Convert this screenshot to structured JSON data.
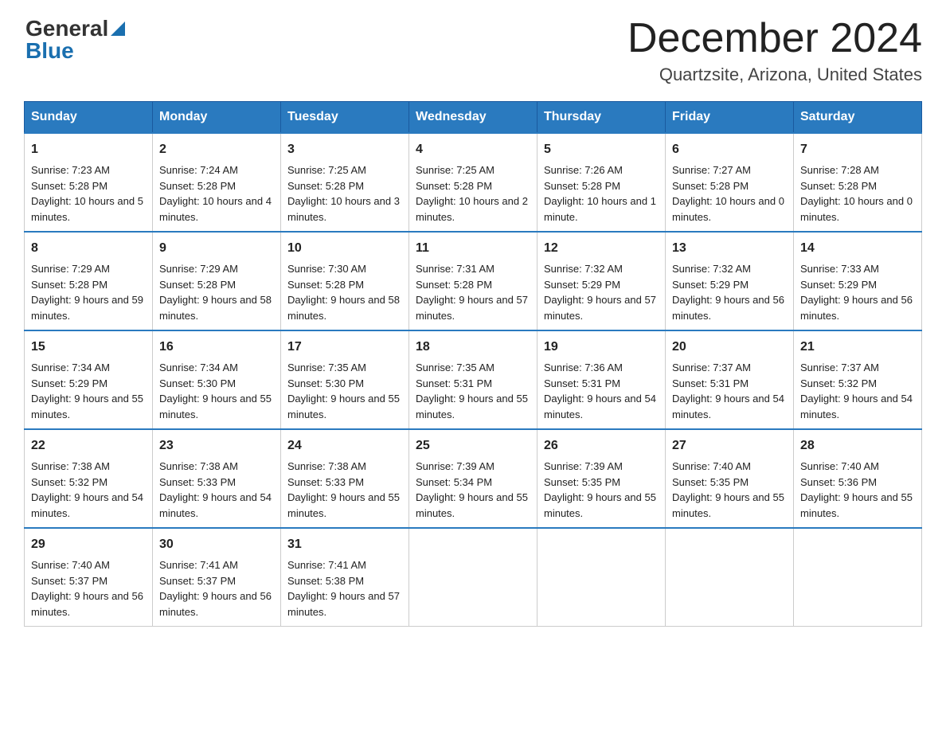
{
  "logo": {
    "general": "General",
    "blue": "Blue"
  },
  "title": "December 2024",
  "subtitle": "Quartzsite, Arizona, United States",
  "weekdays": [
    "Sunday",
    "Monday",
    "Tuesday",
    "Wednesday",
    "Thursday",
    "Friday",
    "Saturday"
  ],
  "weeks": [
    [
      {
        "day": "1",
        "sunrise": "7:23 AM",
        "sunset": "5:28 PM",
        "daylight": "10 hours and 5 minutes."
      },
      {
        "day": "2",
        "sunrise": "7:24 AM",
        "sunset": "5:28 PM",
        "daylight": "10 hours and 4 minutes."
      },
      {
        "day": "3",
        "sunrise": "7:25 AM",
        "sunset": "5:28 PM",
        "daylight": "10 hours and 3 minutes."
      },
      {
        "day": "4",
        "sunrise": "7:25 AM",
        "sunset": "5:28 PM",
        "daylight": "10 hours and 2 minutes."
      },
      {
        "day": "5",
        "sunrise": "7:26 AM",
        "sunset": "5:28 PM",
        "daylight": "10 hours and 1 minute."
      },
      {
        "day": "6",
        "sunrise": "7:27 AM",
        "sunset": "5:28 PM",
        "daylight": "10 hours and 0 minutes."
      },
      {
        "day": "7",
        "sunrise": "7:28 AM",
        "sunset": "5:28 PM",
        "daylight": "10 hours and 0 minutes."
      }
    ],
    [
      {
        "day": "8",
        "sunrise": "7:29 AM",
        "sunset": "5:28 PM",
        "daylight": "9 hours and 59 minutes."
      },
      {
        "day": "9",
        "sunrise": "7:29 AM",
        "sunset": "5:28 PM",
        "daylight": "9 hours and 58 minutes."
      },
      {
        "day": "10",
        "sunrise": "7:30 AM",
        "sunset": "5:28 PM",
        "daylight": "9 hours and 58 minutes."
      },
      {
        "day": "11",
        "sunrise": "7:31 AM",
        "sunset": "5:28 PM",
        "daylight": "9 hours and 57 minutes."
      },
      {
        "day": "12",
        "sunrise": "7:32 AM",
        "sunset": "5:29 PM",
        "daylight": "9 hours and 57 minutes."
      },
      {
        "day": "13",
        "sunrise": "7:32 AM",
        "sunset": "5:29 PM",
        "daylight": "9 hours and 56 minutes."
      },
      {
        "day": "14",
        "sunrise": "7:33 AM",
        "sunset": "5:29 PM",
        "daylight": "9 hours and 56 minutes."
      }
    ],
    [
      {
        "day": "15",
        "sunrise": "7:34 AM",
        "sunset": "5:29 PM",
        "daylight": "9 hours and 55 minutes."
      },
      {
        "day": "16",
        "sunrise": "7:34 AM",
        "sunset": "5:30 PM",
        "daylight": "9 hours and 55 minutes."
      },
      {
        "day": "17",
        "sunrise": "7:35 AM",
        "sunset": "5:30 PM",
        "daylight": "9 hours and 55 minutes."
      },
      {
        "day": "18",
        "sunrise": "7:35 AM",
        "sunset": "5:31 PM",
        "daylight": "9 hours and 55 minutes."
      },
      {
        "day": "19",
        "sunrise": "7:36 AM",
        "sunset": "5:31 PM",
        "daylight": "9 hours and 54 minutes."
      },
      {
        "day": "20",
        "sunrise": "7:37 AM",
        "sunset": "5:31 PM",
        "daylight": "9 hours and 54 minutes."
      },
      {
        "day": "21",
        "sunrise": "7:37 AM",
        "sunset": "5:32 PM",
        "daylight": "9 hours and 54 minutes."
      }
    ],
    [
      {
        "day": "22",
        "sunrise": "7:38 AM",
        "sunset": "5:32 PM",
        "daylight": "9 hours and 54 minutes."
      },
      {
        "day": "23",
        "sunrise": "7:38 AM",
        "sunset": "5:33 PM",
        "daylight": "9 hours and 54 minutes."
      },
      {
        "day": "24",
        "sunrise": "7:38 AM",
        "sunset": "5:33 PM",
        "daylight": "9 hours and 55 minutes."
      },
      {
        "day": "25",
        "sunrise": "7:39 AM",
        "sunset": "5:34 PM",
        "daylight": "9 hours and 55 minutes."
      },
      {
        "day": "26",
        "sunrise": "7:39 AM",
        "sunset": "5:35 PM",
        "daylight": "9 hours and 55 minutes."
      },
      {
        "day": "27",
        "sunrise": "7:40 AM",
        "sunset": "5:35 PM",
        "daylight": "9 hours and 55 minutes."
      },
      {
        "day": "28",
        "sunrise": "7:40 AM",
        "sunset": "5:36 PM",
        "daylight": "9 hours and 55 minutes."
      }
    ],
    [
      {
        "day": "29",
        "sunrise": "7:40 AM",
        "sunset": "5:37 PM",
        "daylight": "9 hours and 56 minutes."
      },
      {
        "day": "30",
        "sunrise": "7:41 AM",
        "sunset": "5:37 PM",
        "daylight": "9 hours and 56 minutes."
      },
      {
        "day": "31",
        "sunrise": "7:41 AM",
        "sunset": "5:38 PM",
        "daylight": "9 hours and 57 minutes."
      },
      null,
      null,
      null,
      null
    ]
  ]
}
